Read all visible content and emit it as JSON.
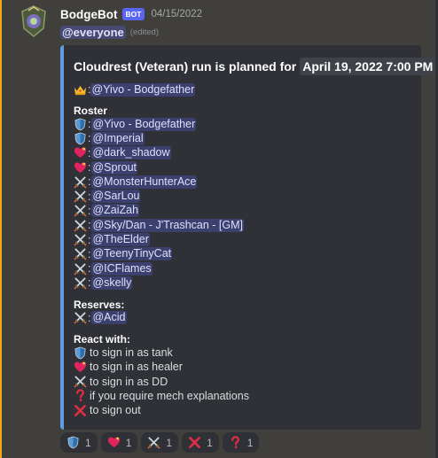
{
  "message": {
    "username": "BodgeBot",
    "bot_tag": "BOT",
    "timestamp": "04/15/2022",
    "content_mention": "@everyone",
    "edited": "(edited)"
  },
  "embed": {
    "title_prefix": "Cloudrest (Veteran) run is planned for",
    "title_date": "April 19, 2022 7:00 PM",
    "leader": {
      "icon": "crown-icon",
      "name": "@Yivo - Bodgefather"
    },
    "roster_title": "Roster",
    "roster": [
      {
        "icon": "shield-icon",
        "name": "@Yivo - Bodgefather"
      },
      {
        "icon": "shield-icon",
        "name": "@Imperial"
      },
      {
        "icon": "heart-icon",
        "name": "@dark_shadow"
      },
      {
        "icon": "heart-icon",
        "name": "@Sprout"
      },
      {
        "icon": "crossed-swords-icon",
        "name": "@MonsterHunterAce"
      },
      {
        "icon": "crossed-swords-icon",
        "name": "@SarLou"
      },
      {
        "icon": "crossed-swords-icon",
        "name": "@ZaiZah"
      },
      {
        "icon": "crossed-swords-icon",
        "name": "@Sky/Dan - J'Trashcan - [GM]"
      },
      {
        "icon": "crossed-swords-icon",
        "name": "@TheElder"
      },
      {
        "icon": "crossed-swords-icon",
        "name": "@TeenyTinyCat"
      },
      {
        "icon": "crossed-swords-icon",
        "name": "@ICFlames"
      },
      {
        "icon": "crossed-swords-icon",
        "name": "@skelly"
      }
    ],
    "reserves_title": "Reserves:",
    "reserves": [
      {
        "icon": "crossed-swords-icon",
        "name": "@Acid"
      }
    ],
    "react_title": "React with:",
    "react_lines": [
      {
        "icon": "shield-icon",
        "text": "to sign in as tank"
      },
      {
        "icon": "heart-icon",
        "text": "to sign in as healer"
      },
      {
        "icon": "crossed-swords-icon",
        "text": "to sign in as DD"
      },
      {
        "icon": "question-icon",
        "text": "if you require mech explanations"
      },
      {
        "icon": "cross-mark-icon",
        "text": "to sign out"
      }
    ]
  },
  "reactions": [
    {
      "icon": "shield-icon",
      "count": "1"
    },
    {
      "icon": "heart-icon",
      "count": "1"
    },
    {
      "icon": "crossed-swords-icon",
      "count": "1"
    },
    {
      "icon": "cross-mark-icon",
      "count": "1"
    },
    {
      "icon": "question-icon",
      "count": "1"
    }
  ],
  "colors": {
    "accent_bar": "#5f9ce4",
    "mention_highlight": "#faa81a",
    "bot_tag": "#5865f2"
  }
}
